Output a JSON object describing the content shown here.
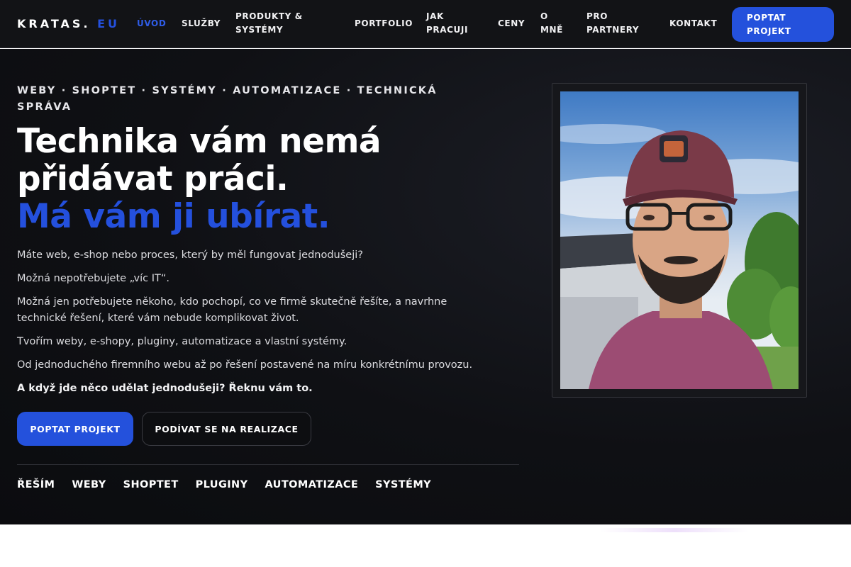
{
  "brand": {
    "name": "KRATAS.",
    "tld": "EU"
  },
  "nav": {
    "items": [
      "ÚVOD",
      "SLUŽBY",
      "PRODUKTY & SYSTÉMY",
      "PORTFOLIO",
      "JAK PRACUJI",
      "CENY",
      "O MNĚ",
      "PRO PARTNERY",
      "KONTAKT"
    ],
    "active": "ÚVOD",
    "cta": "POPTAT PROJEKT"
  },
  "hero": {
    "kicker": "WEBY · SHOPTET · SYSTÉMY · AUTOMATIZACE · TECHNICKÁ SPRÁVA",
    "headline_line1": "Technika vám nemá",
    "headline_line2": "přidávat práci.",
    "headline_accent": "Má vám ji ubírat.",
    "paragraphs": [
      "Máte web, e-shop nebo proces, který by měl fungovat jednodušeji?",
      "Možná nepotřebujete „víc IT“.",
      "Možná jen potřebujete někoho, kdo pochopí, co ve firmě skutečně řešíte, a navrhne technické řešení, které vám nebude komplikovat život.",
      "Tvořím weby, e-shopy, pluginy, automatizace a vlastní systémy.",
      "Od jednoduchého firemního webu až po řešení postavené na míru konkrétnímu provozu."
    ],
    "closing": "A když jde něco udělat jednodušeji? Řeknu vám to.",
    "btn_primary": "POPTAT PROJEKT",
    "btn_secondary": "PODÍVAT SE NA REALIZACE",
    "tags": [
      "ŘEŠÍM",
      "WEBY",
      "SHOPTET",
      "PLUGINY",
      "AUTOMATIZACE",
      "SYSTÉMY"
    ]
  },
  "colors": {
    "accent": "#2450dd",
    "nav_bg": "#121316",
    "hero_bg": "#0f1014"
  },
  "icons": [
    "profile-photo"
  ]
}
